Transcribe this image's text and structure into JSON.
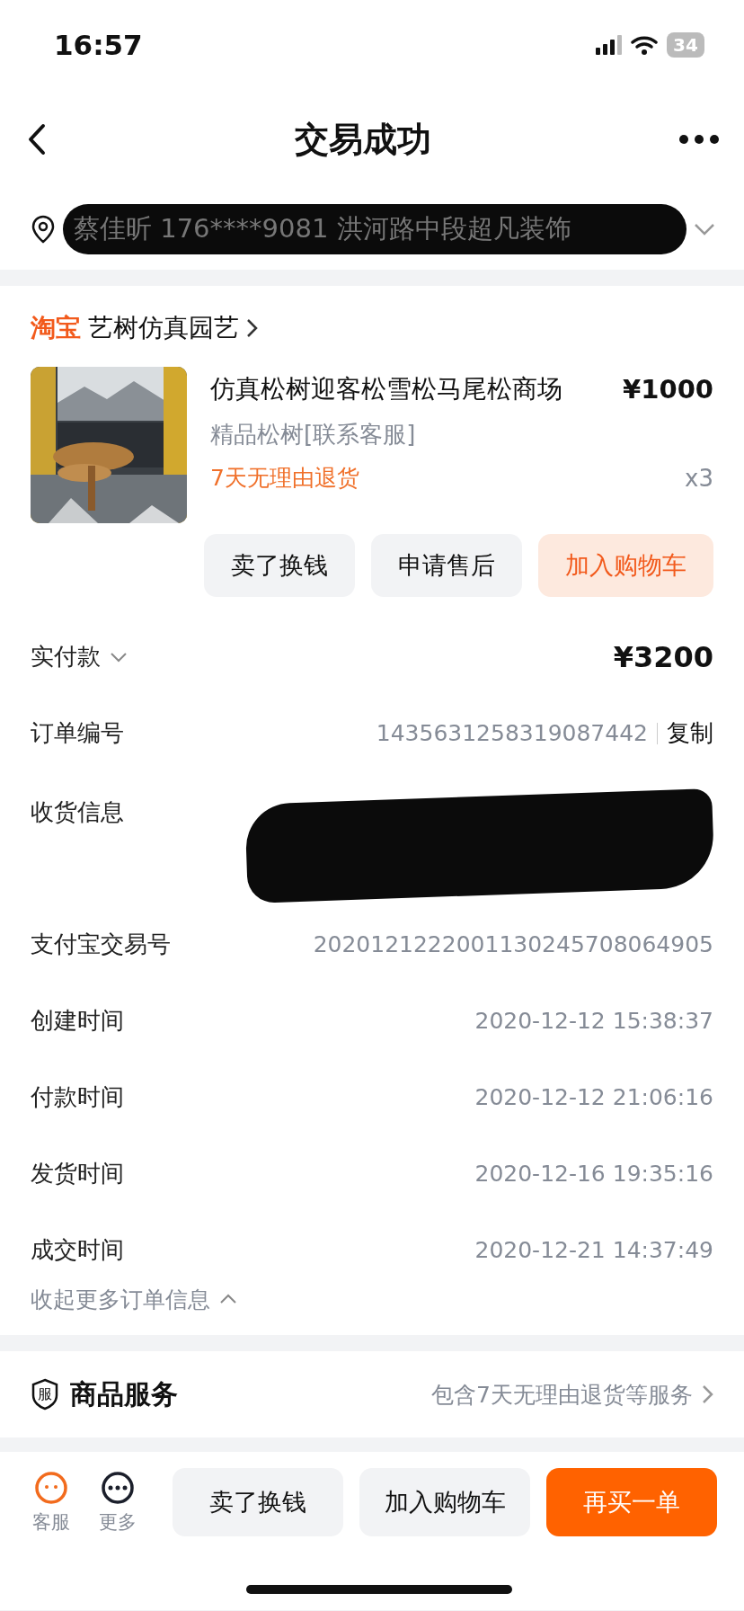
{
  "status_bar": {
    "time": "16:57",
    "battery": "34"
  },
  "nav": {
    "title": "交易成功"
  },
  "address": {
    "text": "蔡佳昕 176****9081 洪河路中段超凡装饰",
    "redacted": true
  },
  "shop": {
    "platform": "淘宝",
    "name": "艺树仿真园艺"
  },
  "item": {
    "kind": "picture",
    "title": "仿真松树迎客松雪松马尾松商场",
    "price": "¥1000",
    "spec": "精品松树[联系客服]",
    "promise": "7天无理由退货",
    "quantity": "x3"
  },
  "item_actions": [
    {
      "label": "卖了换钱",
      "kind": "plain"
    },
    {
      "label": "申请售后",
      "kind": "plain"
    },
    {
      "label": "加入购物车",
      "kind": "soft"
    }
  ],
  "payment": {
    "label": "实付款",
    "amount": "¥3200"
  },
  "details": [
    {
      "kind": "copy",
      "label": "订单编号",
      "value": "1435631258319087442",
      "action": "复制"
    },
    {
      "kind": "redacted",
      "label": "收货信息"
    },
    {
      "kind": "text",
      "label": "支付宝交易号",
      "value": "2020121222001130245708064905"
    },
    {
      "kind": "text",
      "label": "创建时间",
      "value": "2020-12-12 15:38:37"
    },
    {
      "kind": "text",
      "label": "付款时间",
      "value": "2020-12-12 21:06:16"
    },
    {
      "kind": "text",
      "label": "发货时间",
      "value": "2020-12-16 19:35:16"
    },
    {
      "kind": "text",
      "label": "成交时间",
      "value": "2020-12-21 14:37:49"
    }
  ],
  "collapse_link": "收起更多订单信息",
  "service": {
    "title": "商品服务",
    "badge": "服",
    "summary": "包含7天无理由退货等服务"
  },
  "bottom_bar": {
    "icons": [
      {
        "kind": "chat",
        "label": "客服"
      },
      {
        "kind": "more",
        "label": "更多"
      }
    ],
    "buttons": [
      {
        "label": "卖了换钱",
        "kind": "plain"
      },
      {
        "label": "加入购物车",
        "kind": "plain"
      },
      {
        "label": "再买一单",
        "kind": "solid"
      }
    ]
  }
}
